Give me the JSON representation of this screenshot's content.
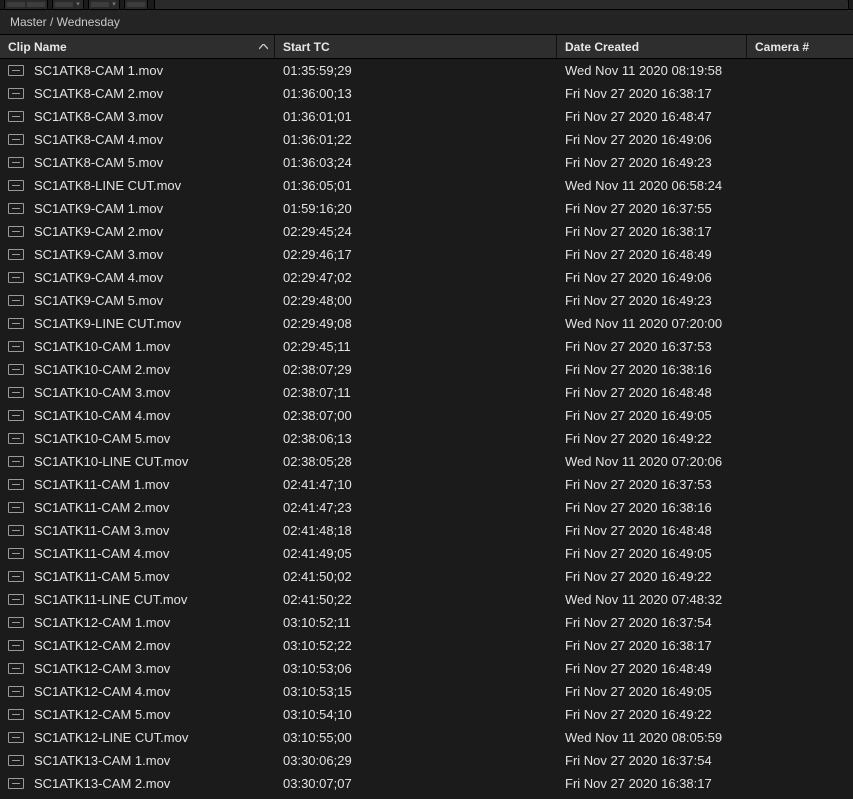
{
  "breadcrumb": "Master / Wednesday",
  "columns": {
    "name": "Clip Name",
    "tc": "Start TC",
    "date": "Date Created",
    "camera": "Camera #"
  },
  "sort": {
    "column": "name",
    "direction": "asc"
  },
  "clips": [
    {
      "name": "SC1ATK8-CAM 1.mov",
      "tc": "01:35:59;29",
      "date": "Wed Nov 11 2020 08:19:58",
      "camera": ""
    },
    {
      "name": "SC1ATK8-CAM 2.mov",
      "tc": "01:36:00;13",
      "date": "Fri Nov 27 2020 16:38:17",
      "camera": ""
    },
    {
      "name": "SC1ATK8-CAM 3.mov",
      "tc": "01:36:01;01",
      "date": "Fri Nov 27 2020 16:48:47",
      "camera": ""
    },
    {
      "name": "SC1ATK8-CAM 4.mov",
      "tc": "01:36:01;22",
      "date": "Fri Nov 27 2020 16:49:06",
      "camera": ""
    },
    {
      "name": "SC1ATK8-CAM 5.mov",
      "tc": "01:36:03;24",
      "date": "Fri Nov 27 2020 16:49:23",
      "camera": ""
    },
    {
      "name": "SC1ATK8-LINE CUT.mov",
      "tc": "01:36:05;01",
      "date": "Wed Nov 11 2020 06:58:24",
      "camera": ""
    },
    {
      "name": "SC1ATK9-CAM 1.mov",
      "tc": "01:59:16;20",
      "date": "Fri Nov 27 2020 16:37:55",
      "camera": ""
    },
    {
      "name": "SC1ATK9-CAM 2.mov",
      "tc": "02:29:45;24",
      "date": "Fri Nov 27 2020 16:38:17",
      "camera": ""
    },
    {
      "name": "SC1ATK9-CAM 3.mov",
      "tc": "02:29:46;17",
      "date": "Fri Nov 27 2020 16:48:49",
      "camera": ""
    },
    {
      "name": "SC1ATK9-CAM 4.mov",
      "tc": "02:29:47;02",
      "date": "Fri Nov 27 2020 16:49:06",
      "camera": ""
    },
    {
      "name": "SC1ATK9-CAM 5.mov",
      "tc": "02:29:48;00",
      "date": "Fri Nov 27 2020 16:49:23",
      "camera": ""
    },
    {
      "name": "SC1ATK9-LINE CUT.mov",
      "tc": "02:29:49;08",
      "date": "Wed Nov 11 2020 07:20:00",
      "camera": ""
    },
    {
      "name": "SC1ATK10-CAM 1.mov",
      "tc": "02:29:45;11",
      "date": "Fri Nov 27 2020 16:37:53",
      "camera": ""
    },
    {
      "name": "SC1ATK10-CAM 2.mov",
      "tc": "02:38:07;29",
      "date": "Fri Nov 27 2020 16:38:16",
      "camera": ""
    },
    {
      "name": "SC1ATK10-CAM 3.mov",
      "tc": "02:38:07;11",
      "date": "Fri Nov 27 2020 16:48:48",
      "camera": ""
    },
    {
      "name": "SC1ATK10-CAM 4.mov",
      "tc": "02:38:07;00",
      "date": "Fri Nov 27 2020 16:49:05",
      "camera": ""
    },
    {
      "name": "SC1ATK10-CAM 5.mov",
      "tc": "02:38:06;13",
      "date": "Fri Nov 27 2020 16:49:22",
      "camera": ""
    },
    {
      "name": "SC1ATK10-LINE CUT.mov",
      "tc": "02:38:05;28",
      "date": "Wed Nov 11 2020 07:20:06",
      "camera": ""
    },
    {
      "name": "SC1ATK11-CAM 1.mov",
      "tc": "02:41:47;10",
      "date": "Fri Nov 27 2020 16:37:53",
      "camera": ""
    },
    {
      "name": "SC1ATK11-CAM 2.mov",
      "tc": "02:41:47;23",
      "date": "Fri Nov 27 2020 16:38:16",
      "camera": ""
    },
    {
      "name": "SC1ATK11-CAM 3.mov",
      "tc": "02:41:48;18",
      "date": "Fri Nov 27 2020 16:48:48",
      "camera": ""
    },
    {
      "name": "SC1ATK11-CAM 4.mov",
      "tc": "02:41:49;05",
      "date": "Fri Nov 27 2020 16:49:05",
      "camera": ""
    },
    {
      "name": "SC1ATK11-CAM 5.mov",
      "tc": "02:41:50;02",
      "date": "Fri Nov 27 2020 16:49:22",
      "camera": ""
    },
    {
      "name": "SC1ATK11-LINE CUT.mov",
      "tc": "02:41:50;22",
      "date": "Wed Nov 11 2020 07:48:32",
      "camera": ""
    },
    {
      "name": "SC1ATK12-CAM 1.mov",
      "tc": "03:10:52;11",
      "date": "Fri Nov 27 2020 16:37:54",
      "camera": ""
    },
    {
      "name": "SC1ATK12-CAM 2.mov",
      "tc": "03:10:52;22",
      "date": "Fri Nov 27 2020 16:38:17",
      "camera": ""
    },
    {
      "name": "SC1ATK12-CAM 3.mov",
      "tc": "03:10:53;06",
      "date": "Fri Nov 27 2020 16:48:49",
      "camera": ""
    },
    {
      "name": "SC1ATK12-CAM 4.mov",
      "tc": "03:10:53;15",
      "date": "Fri Nov 27 2020 16:49:05",
      "camera": ""
    },
    {
      "name": "SC1ATK12-CAM 5.mov",
      "tc": "03:10:54;10",
      "date": "Fri Nov 27 2020 16:49:22",
      "camera": ""
    },
    {
      "name": "SC1ATK12-LINE CUT.mov",
      "tc": "03:10:55;00",
      "date": "Wed Nov 11 2020 08:05:59",
      "camera": ""
    },
    {
      "name": "SC1ATK13-CAM 1.mov",
      "tc": "03:30:06;29",
      "date": "Fri Nov 27 2020 16:37:54",
      "camera": ""
    },
    {
      "name": "SC1ATK13-CAM 2.mov",
      "tc": "03:30:07;07",
      "date": "Fri Nov 27 2020 16:38:17",
      "camera": ""
    }
  ]
}
